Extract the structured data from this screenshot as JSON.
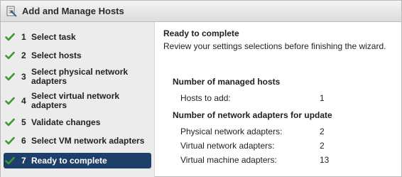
{
  "window": {
    "title": "Add and Manage Hosts"
  },
  "steps": [
    {
      "num": "1",
      "label": "Select task",
      "done": true
    },
    {
      "num": "2",
      "label": "Select hosts",
      "done": true
    },
    {
      "num": "3",
      "label": "Select physical network adapters",
      "done": true
    },
    {
      "num": "4",
      "label": "Select virtual network adapters",
      "done": true
    },
    {
      "num": "5",
      "label": "Validate changes",
      "done": true
    },
    {
      "num": "6",
      "label": "Select VM network adapters",
      "done": true
    },
    {
      "num": "7",
      "label": "Ready to complete",
      "done": true,
      "active": true
    }
  ],
  "main": {
    "title": "Ready to complete",
    "subtitle": "Review your settings selections before finishing the wizard.",
    "section_hosts": {
      "heading": "Number of managed hosts",
      "rows": [
        {
          "key": "Hosts to add:",
          "value": "1"
        }
      ]
    },
    "section_adapters": {
      "heading": "Number of network adapters for update",
      "rows": [
        {
          "key": "Physical network adapters:",
          "value": "2"
        },
        {
          "key": "Virtual network adapters:",
          "value": "2"
        },
        {
          "key": "Virtual machine adapters:",
          "value": "13"
        }
      ]
    }
  },
  "colors": {
    "check": "#3a9b2c",
    "active_bg": "#1f3f6b"
  }
}
